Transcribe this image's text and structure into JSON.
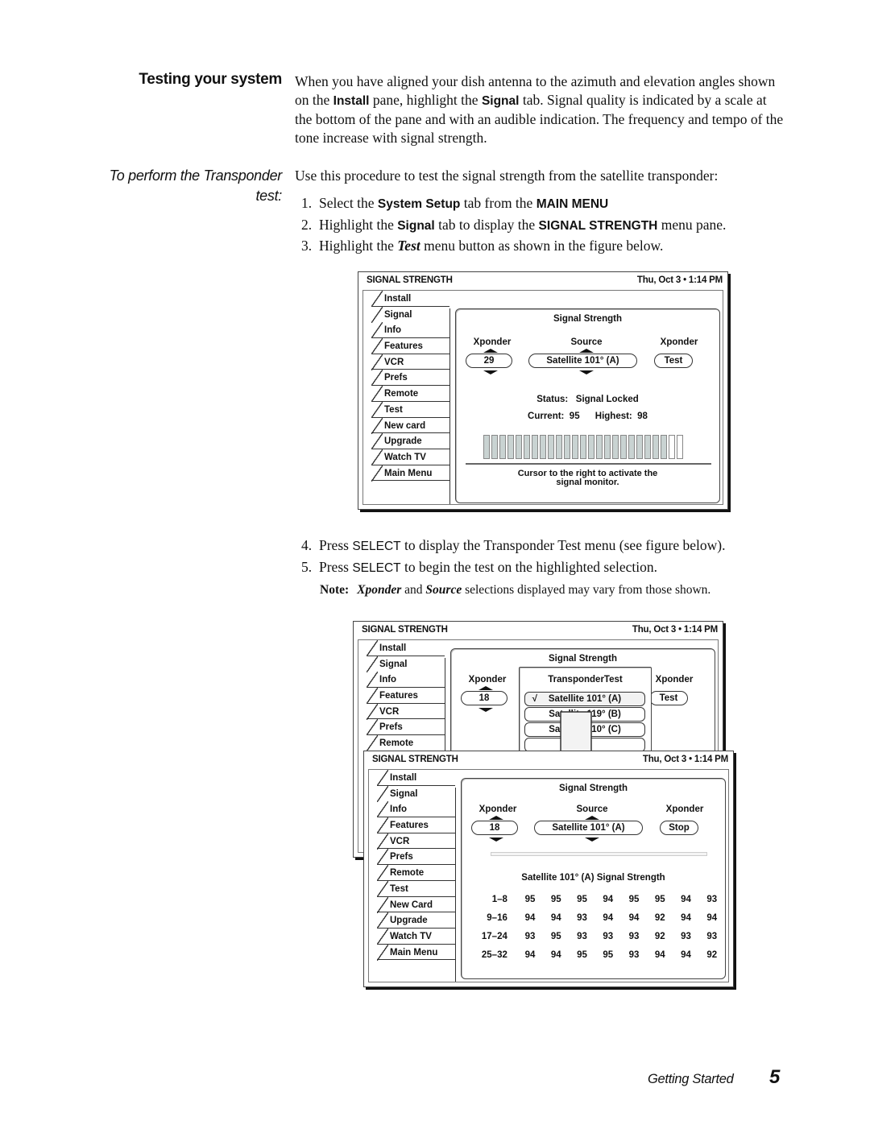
{
  "section": {
    "heading": "Testing your system",
    "intro_parts": [
      "When you have aligned your dish antenna to the azimuth and elevation angles shown on the ",
      "Install",
      " pane, highlight the ",
      "Signal",
      " tab. Signal quality is indicated by a scale at the bottom of the pane and with an audible indication. The frequency and tempo of the tone increase with signal strength."
    ]
  },
  "procedure": {
    "heading": "To perform the Transponder test:",
    "intro": "Use this procedure to test the signal strength from the satellite transponder:",
    "steps_a": [
      {
        "num": "1.",
        "parts": [
          "Select the ",
          "System Setup",
          " tab from the ",
          "MAIN MENU",
          ""
        ]
      },
      {
        "num": "2.",
        "parts": [
          "Highlight the ",
          "Signal",
          " tab to display the ",
          "SIGNAL STRENGTH",
          " menu pane."
        ]
      },
      {
        "num": "3.",
        "parts": [
          "Highlight the ",
          "Test",
          " menu button as shown in the figure below.",
          "",
          ""
        ]
      }
    ],
    "steps_b": [
      {
        "num": "4.",
        "parts": [
          "Press ",
          "SELECT",
          " to display the Transponder Test menu (see figure below)."
        ]
      },
      {
        "num": "5.",
        "parts": [
          "Press ",
          "SELECT",
          " to begin the test on the highlighted selection."
        ]
      }
    ],
    "note": {
      "label": "Note:",
      "parts": [
        "Xponder",
        " and ",
        "Source",
        " selections displayed may vary from those shown."
      ]
    }
  },
  "figure1": {
    "title": "SIGNAL STRENGTH",
    "clock": "Thu, Oct 3  •  1:14 PM",
    "tabs": [
      "Install",
      "Signal",
      "Info",
      "Features",
      "VCR",
      "Prefs",
      "Remote",
      "Test",
      "New card",
      "Upgrade",
      "Watch TV",
      "Main Menu"
    ],
    "active_tab": "Signal",
    "panel_title": "Signal Strength",
    "col1_label": "Xponder",
    "col2_label": "Source",
    "col3_label": "Xponder",
    "xponder_value": "29",
    "source_value": "Satellite 101° (A)",
    "button_label": "Test",
    "status_label": "Status:",
    "status_value": "Signal Locked",
    "current_label": "Current:",
    "current_value": "95",
    "highest_label": "Highest:",
    "highest_value": "98",
    "meter": {
      "total_segments": 25,
      "filled_segments": 23
    },
    "hint_line1": "Cursor to the right to activate the",
    "hint_line2": "signal monitor."
  },
  "figure2_back": {
    "title": "SIGNAL STRENGTH",
    "clock": "Thu, Oct 3  •  1:14 PM",
    "tabs": [
      "Install",
      "Signal",
      "Info",
      "Features",
      "VCR",
      "Prefs",
      "Remote"
    ],
    "panel_title": "Signal Strength",
    "col1_label": "Xponder",
    "col3_label": "Xponder",
    "xponder_value": "18",
    "button_label": "Test",
    "popup": {
      "title": "TransponderTest",
      "check": "√",
      "options": [
        "Satellite 101° (A)",
        "Satellite 119° (B)",
        "Satellite 110° (C)"
      ],
      "selected_index": 0
    }
  },
  "figure2_front": {
    "title": "SIGNAL STRENGTH",
    "clock": "Thu, Oct 3  •  1:14 PM",
    "tabs": [
      "Install",
      "Signal",
      "Info",
      "Features",
      "VCR",
      "Prefs",
      "Remote",
      "Test",
      "New Card",
      "Upgrade",
      "Watch TV",
      "Main Menu"
    ],
    "active_tab": "Signal",
    "panel_title": "Signal Strength",
    "col1_label": "Xponder",
    "col2_label": "Source",
    "col3_label": "Xponder",
    "xponder_value": "18",
    "source_value": "Satellite 101° (A)",
    "button_label": "Stop",
    "table_title": "Satellite 101° (A) Signal Strength",
    "rows": [
      {
        "label": "1–8",
        "values": [
          "95",
          "95",
          "95",
          "94",
          "95",
          "95",
          "94",
          "93"
        ]
      },
      {
        "label": "9–16",
        "values": [
          "94",
          "94",
          "93",
          "94",
          "94",
          "92",
          "94",
          "94"
        ]
      },
      {
        "label": "17–24",
        "values": [
          "93",
          "95",
          "93",
          "93",
          "93",
          "92",
          "93",
          "93"
        ]
      },
      {
        "label": "25–32",
        "values": [
          "94",
          "94",
          "95",
          "95",
          "93",
          "94",
          "94",
          "92"
        ]
      }
    ]
  },
  "footer": {
    "section_label": "Getting Started",
    "page_number": "5"
  }
}
